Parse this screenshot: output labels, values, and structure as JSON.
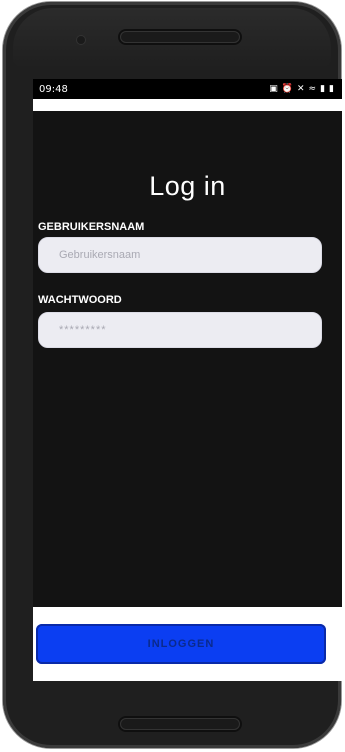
{
  "status_bar": {
    "time": "09:48",
    "icons": [
      "lock-icon",
      "alarm-icon",
      "mute-icon",
      "wifi-icon",
      "signal-icon",
      "battery-icon"
    ]
  },
  "login": {
    "title": "Log in",
    "username_label": "GEBRUIKERSNAAM",
    "username_placeholder": "Gebruikersnaam",
    "password_label": "WACHTWOORD",
    "password_placeholder": "*********",
    "submit_label": "INLOGGEN"
  },
  "colors": {
    "screen_bg": "#131313",
    "field_bg": "#ececf2",
    "button_bg": "#0b3ef2",
    "button_text": "#0a2a8c"
  }
}
